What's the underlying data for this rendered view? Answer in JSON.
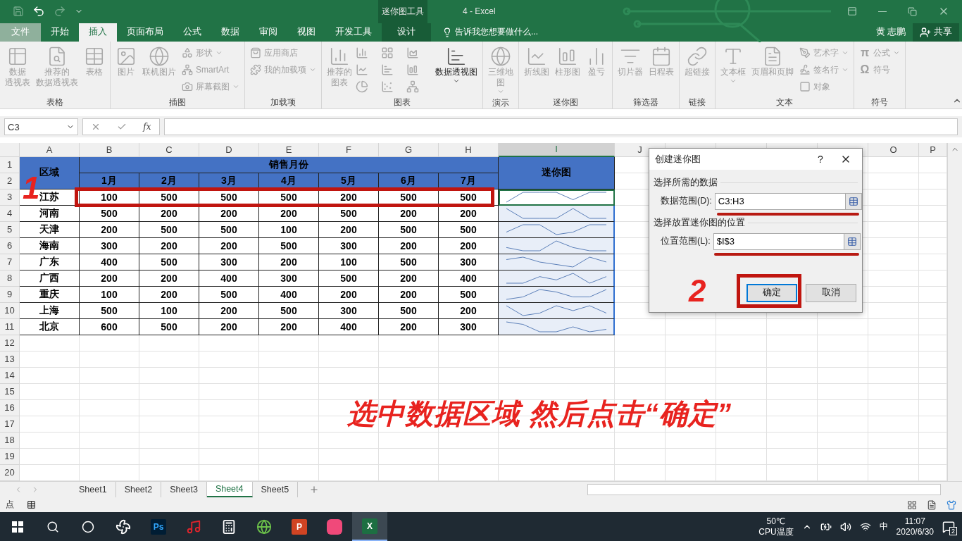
{
  "title_bar": {
    "contextual_group": "迷你图工具",
    "title": "4 - Excel",
    "user": "黄 志鹏",
    "share": "共享"
  },
  "tabs": [
    {
      "label": "文件",
      "kind": "file",
      "selected": false
    },
    {
      "label": "开始",
      "kind": "normal",
      "selected": false
    },
    {
      "label": "插入",
      "kind": "normal",
      "selected": true
    },
    {
      "label": "页面布局",
      "kind": "normal",
      "selected": false
    },
    {
      "label": "公式",
      "kind": "normal",
      "selected": false
    },
    {
      "label": "数据",
      "kind": "normal",
      "selected": false
    },
    {
      "label": "审阅",
      "kind": "normal",
      "selected": false
    },
    {
      "label": "视图",
      "kind": "normal",
      "selected": false
    },
    {
      "label": "开发工具",
      "kind": "normal",
      "selected": false
    },
    {
      "label": "设计",
      "kind": "contextual",
      "selected": false
    }
  ],
  "tell_me": "告诉我您想要做什么...",
  "ribbon": {
    "groups": [
      {
        "label": "表格",
        "items": [
          {
            "kind": "large",
            "label": [
              "数据",
              "透视表"
            ],
            "disabled": true
          },
          {
            "kind": "large",
            "label": [
              "推荐的",
              "数据透视表"
            ],
            "disabled": true
          },
          {
            "kind": "large",
            "label": [
              "表格"
            ],
            "disabled": true
          }
        ]
      },
      {
        "label": "插图",
        "items": [
          {
            "kind": "large",
            "label": [
              "图片"
            ],
            "disabled": true
          },
          {
            "kind": "large",
            "label": [
              "联机图片"
            ],
            "disabled": true
          },
          {
            "kind": "stack",
            "items": [
              {
                "label": "形状",
                "dropdown": true,
                "disabled": true
              },
              {
                "label": "SmartArt",
                "dropdown": false,
                "disabled": true
              },
              {
                "label": "屏幕截图",
                "dropdown": true,
                "disabled": true
              }
            ]
          }
        ]
      },
      {
        "label": "加载项",
        "items": [
          {
            "kind": "stack",
            "items": [
              {
                "label": "应用商店",
                "dropdown": false,
                "disabled": true
              },
              {
                "label": "我的加载项",
                "dropdown": true,
                "disabled": true
              }
            ]
          }
        ]
      },
      {
        "label": "图表",
        "items": [
          {
            "kind": "large",
            "label": [
              "推荐的",
              "图表"
            ],
            "disabled": true
          },
          {
            "kind": "chart-grid",
            "disabled": true
          },
          {
            "kind": "large",
            "label": [
              "数据透视图"
            ],
            "dropdown": true,
            "disabled": false
          }
        ]
      },
      {
        "label": "演示",
        "items": [
          {
            "kind": "large",
            "label": [
              "三维地",
              "图"
            ],
            "dropdown": true,
            "disabled": true
          }
        ]
      },
      {
        "label": "迷你图",
        "items": [
          {
            "kind": "large",
            "label": [
              "折线图"
            ],
            "disabled": true
          },
          {
            "kind": "large",
            "label": [
              "柱形图"
            ],
            "disabled": true
          },
          {
            "kind": "large",
            "label": [
              "盈亏"
            ],
            "disabled": true
          }
        ]
      },
      {
        "label": "筛选器",
        "items": [
          {
            "kind": "large",
            "label": [
              "切片器"
            ],
            "disabled": true
          },
          {
            "kind": "large",
            "label": [
              "日程表"
            ],
            "disabled": true
          }
        ]
      },
      {
        "label": "链接",
        "items": [
          {
            "kind": "large",
            "label": [
              "超链接"
            ],
            "disabled": true
          }
        ]
      },
      {
        "label": "文本",
        "items": [
          {
            "kind": "large",
            "label": [
              "文本框"
            ],
            "dropdown": true,
            "disabled": true
          },
          {
            "kind": "large",
            "label": [
              "页眉和页脚"
            ],
            "disabled": true
          },
          {
            "kind": "stack",
            "items": [
              {
                "label": "艺术字",
                "dropdown": true,
                "disabled": true
              },
              {
                "label": "签名行",
                "dropdown": true,
                "disabled": true
              },
              {
                "label": "对象",
                "dropdown": false,
                "disabled": true
              }
            ]
          }
        ]
      },
      {
        "label": "符号",
        "items": [
          {
            "kind": "stack",
            "items": [
              {
                "glyph": "π",
                "label": "公式",
                "dropdown": true,
                "disabled": true
              },
              {
                "glyph": "Ω",
                "label": "符号",
                "dropdown": false,
                "disabled": true
              }
            ]
          }
        ]
      }
    ]
  },
  "formula_bar": {
    "name_box": "C3",
    "fx": "fx"
  },
  "columns": [
    {
      "label": "A",
      "selected": false
    },
    {
      "label": "B",
      "selected": false
    },
    {
      "label": "C",
      "selected": false
    },
    {
      "label": "D",
      "selected": false
    },
    {
      "label": "E",
      "selected": false
    },
    {
      "label": "F",
      "selected": false
    },
    {
      "label": "G",
      "selected": false
    },
    {
      "label": "H",
      "selected": false
    },
    {
      "label": "I",
      "selected": true
    },
    {
      "label": "J",
      "selected": false
    },
    {
      "selected": false
    },
    {
      "selected": false
    },
    {
      "selected": false
    },
    {
      "selected": false
    },
    {
      "label": "O",
      "selected": false
    },
    {
      "label": "P",
      "selected": false
    }
  ],
  "row_headers": [
    "1",
    "2",
    "3",
    "4",
    "5",
    "6",
    "7",
    "8",
    "9",
    "10",
    "11",
    "12",
    "13",
    "14",
    "15",
    "16",
    "17",
    "18",
    "19",
    "20"
  ],
  "table": {
    "region_header": "区域",
    "group_header": "销售月份",
    "months": [
      "1月",
      "2月",
      "3月",
      "4月",
      "5月",
      "6月",
      "7月"
    ],
    "sparkline_header": "迷你图",
    "rows": [
      {
        "region": "江苏",
        "values": [
          "100",
          "500",
          "500",
          "500",
          "200",
          "500",
          "500"
        ],
        "active": true
      },
      {
        "region": "河南",
        "values": [
          "500",
          "200",
          "200",
          "200",
          "500",
          "200",
          "200"
        ],
        "active": false
      },
      {
        "region": "天津",
        "values": [
          "200",
          "500",
          "500",
          "100",
          "200",
          "500",
          "500"
        ],
        "active": false
      },
      {
        "region": "海南",
        "values": [
          "300",
          "200",
          "200",
          "500",
          "300",
          "200",
          "200"
        ],
        "active": false
      },
      {
        "region": "广东",
        "values": [
          "400",
          "500",
          "300",
          "200",
          "100",
          "500",
          "300"
        ],
        "active": false
      },
      {
        "region": "广西",
        "values": [
          "200",
          "200",
          "400",
          "300",
          "500",
          "200",
          "400"
        ],
        "active": false
      },
      {
        "region": "重庆",
        "values": [
          "100",
          "200",
          "500",
          "400",
          "200",
          "200",
          "500"
        ],
        "active": false
      },
      {
        "region": "上海",
        "values": [
          "500",
          "100",
          "200",
          "500",
          "300",
          "500",
          "200"
        ],
        "active": false
      },
      {
        "region": "北京",
        "values": [
          "600",
          "500",
          "200",
          "200",
          "400",
          "200",
          "300"
        ],
        "active": false
      }
    ]
  },
  "dialog": {
    "title": "创建迷你图",
    "help": "?",
    "sections": [
      {
        "heading": "选择所需的数据",
        "label": "数据范围(D):",
        "value": "C3:H3"
      },
      {
        "heading": "选择放置迷你图的位置",
        "label": "位置范围(L):",
        "value": "$I$3"
      }
    ],
    "buttons": [
      {
        "label": "确定",
        "default": true
      },
      {
        "label": "取消",
        "default": false
      }
    ]
  },
  "annotations": {
    "step_1": "1",
    "step_2": "2",
    "caption": "选中数据区域 然后点击“确定”"
  },
  "sheet_tabs": [
    {
      "label": "Sheet1",
      "selected": false
    },
    {
      "label": "Sheet2",
      "selected": false
    },
    {
      "label": "Sheet3",
      "selected": false
    },
    {
      "label": "Sheet4",
      "selected": true
    },
    {
      "label": "Sheet5",
      "selected": false
    }
  ],
  "status_bar": {
    "mode": "点"
  },
  "taskbar": {
    "apps": [
      {
        "kind": "start",
        "selected": false
      },
      {
        "kind": "search",
        "selected": false
      },
      {
        "kind": "cortana",
        "selected": false
      },
      {
        "kind": "fan",
        "selected": false
      },
      {
        "kind": "ps",
        "label": "Ps",
        "selected": false
      },
      {
        "kind": "music",
        "selected": false
      },
      {
        "kind": "calculator",
        "selected": false
      },
      {
        "kind": "browser",
        "selected": false
      },
      {
        "kind": "powerpoint",
        "label": "P",
        "selected": false
      },
      {
        "kind": "app",
        "selected": false
      },
      {
        "kind": "excel",
        "label": "X",
        "selected": true
      }
    ],
    "temperature": "50℃",
    "temperature_label": "CPU温度",
    "ime": "中",
    "time": "11:07",
    "date": "2020/6/30",
    "notifications": "2"
  }
}
